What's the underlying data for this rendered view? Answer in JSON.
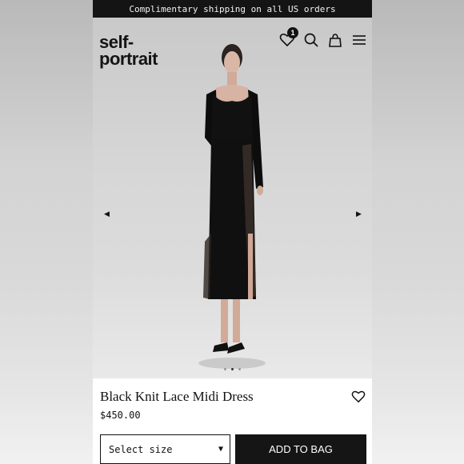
{
  "promo": {
    "text": "Complimentary shipping on all US orders"
  },
  "brand": {
    "line1": "self-",
    "line2": "portrait"
  },
  "header": {
    "wishlist_count": "1",
    "icons": [
      "heart-icon",
      "search-icon",
      "bag-icon",
      "menu-icon"
    ]
  },
  "gallery": {
    "prev_arrow": "◀",
    "next_arrow": "▶",
    "slides": 3,
    "active_slide": 2
  },
  "product": {
    "name": "Black Knit Lace Midi Dress",
    "price": "$450.00",
    "size_placeholder": "Select size",
    "add_to_bag": "ADD TO BAG"
  },
  "colors": {
    "promo_bg": "#141414",
    "button_bg": "#151515",
    "text": "#111111"
  }
}
